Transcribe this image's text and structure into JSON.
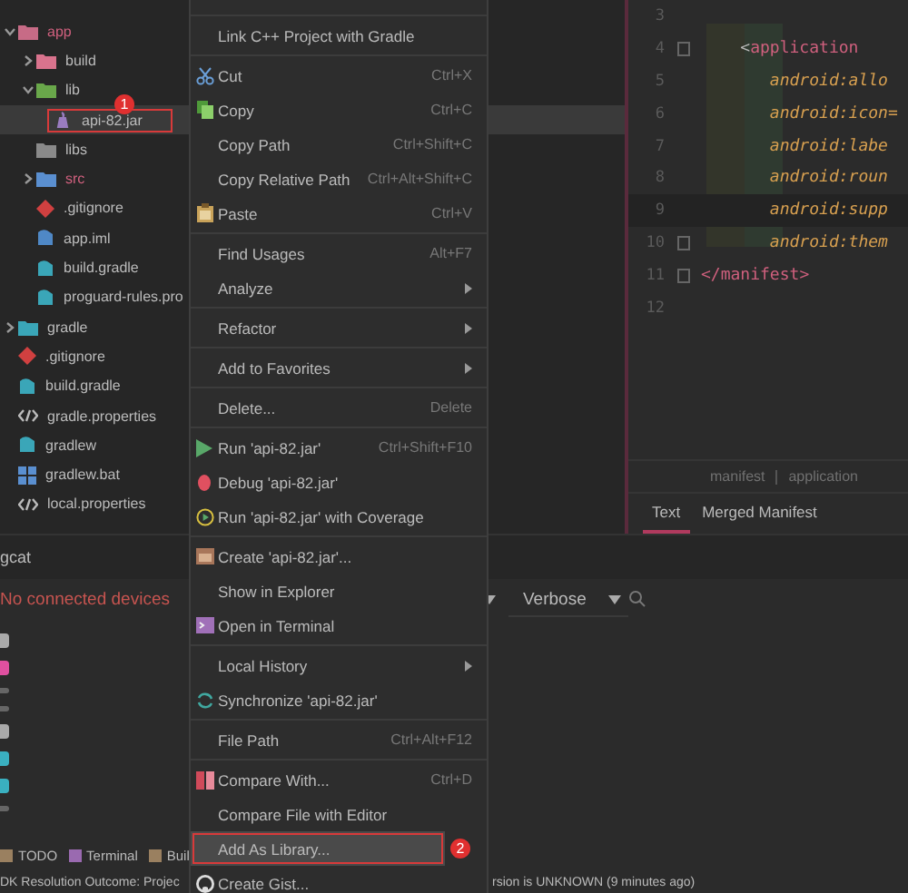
{
  "project_tree": [
    {
      "name": "app",
      "kind": "module",
      "expanded": true,
      "selected": false,
      "children": [
        {
          "name": "build",
          "kind": "build-folder",
          "expanded": false,
          "selected": false
        },
        {
          "name": "lib",
          "kind": "lib-folder",
          "expanded": true,
          "selected": false,
          "children": [
            {
              "name": "api-82.jar",
              "kind": "jar",
              "selected": true,
              "callout": "1"
            }
          ]
        },
        {
          "name": "libs",
          "kind": "folder",
          "selected": false
        },
        {
          "name": "src",
          "kind": "source",
          "expanded": false,
          "selected": false
        },
        {
          "name": ".gitignore",
          "kind": "git",
          "selected": false
        },
        {
          "name": "app.iml",
          "kind": "iml",
          "selected": false
        },
        {
          "name": "build.gradle",
          "kind": "gradle",
          "selected": false
        },
        {
          "name": "proguard-rules.pro",
          "kind": "pro",
          "selected": false
        }
      ]
    },
    {
      "name": "gradle",
      "kind": "gradle-folder",
      "expanded": false,
      "selected": false
    },
    {
      "name": ".gitignore",
      "kind": "git",
      "selected": false
    },
    {
      "name": "build.gradle",
      "kind": "gradle",
      "selected": false
    },
    {
      "name": "gradle.properties",
      "kind": "properties",
      "selected": false
    },
    {
      "name": "gradlew",
      "kind": "gradle",
      "selected": false
    },
    {
      "name": "gradlew.bat",
      "kind": "batch",
      "selected": false
    },
    {
      "name": "local.properties",
      "kind": "properties",
      "selected": false
    }
  ],
  "context_menu": [
    {
      "kind": "separator"
    },
    {
      "kind": "item",
      "label": "Link C++ Project with Gradle",
      "selected": false
    },
    {
      "kind": "separator"
    },
    {
      "kind": "item",
      "label": "Cut",
      "shortcut": "Ctrl+X",
      "selected": false
    },
    {
      "kind": "item",
      "label": "Copy",
      "shortcut": "Ctrl+C",
      "selected": false
    },
    {
      "kind": "item",
      "label": "Copy Path",
      "shortcut": "Ctrl+Shift+C",
      "selected": false
    },
    {
      "kind": "item",
      "label": "Copy Relative Path",
      "shortcut": "Ctrl+Alt+Shift+C",
      "selected": false
    },
    {
      "kind": "item",
      "label": "Paste",
      "shortcut": "Ctrl+V",
      "selected": false
    },
    {
      "kind": "separator"
    },
    {
      "kind": "item",
      "label": "Find Usages",
      "shortcut": "Alt+F7",
      "selected": false
    },
    {
      "kind": "item",
      "label": "Analyze",
      "submenu": true,
      "selected": false
    },
    {
      "kind": "separator"
    },
    {
      "kind": "item",
      "label": "Refactor",
      "submenu": true,
      "selected": false
    },
    {
      "kind": "separator"
    },
    {
      "kind": "item",
      "label": "Add to Favorites",
      "submenu": true,
      "selected": false
    },
    {
      "kind": "separator"
    },
    {
      "kind": "item",
      "label": "Delete...",
      "shortcut": "Delete",
      "selected": false
    },
    {
      "kind": "separator"
    },
    {
      "kind": "item",
      "label": "Run 'api-82.jar'",
      "shortcut": "Ctrl+Shift+F10",
      "selected": false
    },
    {
      "kind": "item",
      "label": "Debug 'api-82.jar'",
      "selected": false
    },
    {
      "kind": "item",
      "label": "Run 'api-82.jar' with Coverage",
      "selected": false
    },
    {
      "kind": "separator"
    },
    {
      "kind": "item",
      "label": "Create 'api-82.jar'...",
      "selected": false
    },
    {
      "kind": "item",
      "label": "Show in Explorer",
      "selected": false
    },
    {
      "kind": "item",
      "label": "Open in Terminal",
      "selected": false
    },
    {
      "kind": "separator"
    },
    {
      "kind": "item",
      "label": "Local History",
      "submenu": true,
      "selected": false
    },
    {
      "kind": "item",
      "label": "Synchronize 'api-82.jar'",
      "selected": false
    },
    {
      "kind": "separator"
    },
    {
      "kind": "item",
      "label": "File Path",
      "shortcut": "Ctrl+Alt+F12",
      "selected": false
    },
    {
      "kind": "separator"
    },
    {
      "kind": "item",
      "label": "Compare With...",
      "shortcut": "Ctrl+D",
      "selected": false
    },
    {
      "kind": "item",
      "label": "Compare File with Editor",
      "selected": false
    },
    {
      "kind": "item",
      "label": "Add As Library...",
      "selected": true,
      "callout": "2"
    },
    {
      "kind": "item",
      "label": "Create Gist...",
      "selected": false
    }
  ],
  "editor": {
    "lines": [
      {
        "number": "3",
        "current": false,
        "fold": false
      },
      {
        "number": "4",
        "current": false,
        "fold": true,
        "tokens": [
          {
            "text": "    <",
            "kind": "punct"
          },
          {
            "text": "application",
            "kind": "tag"
          }
        ]
      },
      {
        "number": "5",
        "current": false,
        "fold": false,
        "tokens": [
          {
            "text": "       android:allo",
            "kind": "attr"
          }
        ]
      },
      {
        "number": "6",
        "current": false,
        "fold": false,
        "tokens": [
          {
            "text": "       android:icon=",
            "kind": "attr"
          }
        ]
      },
      {
        "number": "7",
        "current": false,
        "fold": false,
        "tokens": [
          {
            "text": "       android:labe",
            "kind": "attr"
          }
        ]
      },
      {
        "number": "8",
        "current": false,
        "fold": false,
        "tokens": [
          {
            "text": "       android:roun",
            "kind": "attr"
          }
        ]
      },
      {
        "number": "9",
        "current": true,
        "fold": false,
        "tokens": [
          {
            "text": "       android:supp",
            "kind": "attr"
          }
        ]
      },
      {
        "number": "10",
        "current": false,
        "fold": true,
        "tokens": [
          {
            "text": "       android:them",
            "kind": "attr"
          }
        ]
      },
      {
        "number": "11",
        "current": false,
        "fold": true,
        "tokens": [
          {
            "text": "</",
            "kind": "tag"
          },
          {
            "text": "manifest",
            "kind": "tag"
          },
          {
            "text": ">",
            "kind": "tag"
          }
        ]
      },
      {
        "number": "12",
        "current": false,
        "fold": false
      }
    ],
    "breadcrumb": [
      "manifest",
      "application"
    ],
    "tabs": [
      {
        "label": "Text",
        "selected": true
      },
      {
        "label": "Merged Manifest",
        "selected": false
      }
    ]
  },
  "logcat": {
    "title": "gcat",
    "device_message": "No connected devices",
    "log_level": "Verbose"
  },
  "tool_tabs": [
    "TODO",
    "Terminal",
    "Buil"
  ],
  "status_bar": {
    "left": "DK Resolution Outcome: Projec",
    "right": "rsion is UNKNOWN (9 minutes ago)"
  }
}
